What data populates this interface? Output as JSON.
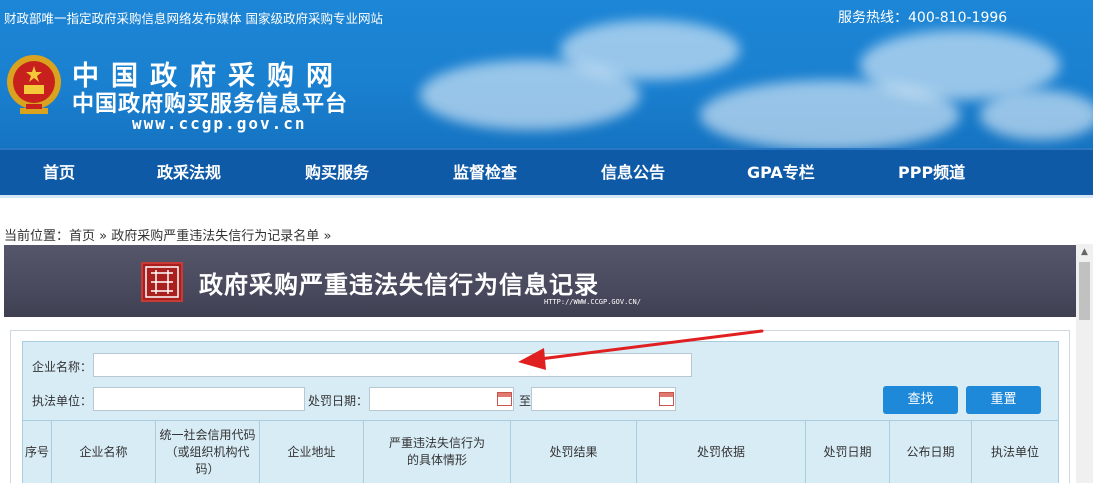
{
  "header": {
    "tagline": "财政部唯一指定政府采购信息网络发布媒体 国家级政府采购专业网站",
    "hotline": "服务热线：400-810-1996",
    "logo_line1": "中国政府采购网",
    "logo_line2": "中国政府购买服务信息平台",
    "logo_url": "www.ccgp.gov.cn"
  },
  "nav": {
    "items": [
      "首页",
      "政采法规",
      "购买服务",
      "监督检查",
      "信息公告",
      "GPA专栏",
      "PPP频道"
    ]
  },
  "breadcrumb": {
    "prefix": "当前位置：",
    "home": "首页",
    "sep": "»",
    "current": "政府采购严重违法失信行为记录名单",
    "trail": "»"
  },
  "banner": {
    "title": "政府采购严重违法失信行为信息记录",
    "url": "HTTP://WWW.CCGP.GOV.CN/"
  },
  "search": {
    "company_label": "企业名称：",
    "company_value": "",
    "agency_label": "执法单位：",
    "agency_value": "",
    "date_label": "处罚日期：",
    "date_from": "",
    "date_to_label": "至",
    "date_to": "",
    "search_button": "查找",
    "reset_button": "重置"
  },
  "table": {
    "headers": [
      [
        "序号"
      ],
      [
        "企业名称"
      ],
      [
        "统一社会信用代码",
        "（或组织机构代",
        "码）"
      ],
      [
        "企业地址"
      ],
      [
        "严重违法失信行为",
        "的具体情形"
      ],
      [
        "处罚结果"
      ],
      [
        "处罚依据"
      ],
      [
        "处罚日期"
      ],
      [
        "公布日期"
      ],
      [
        "执法单位"
      ]
    ]
  },
  "colors": {
    "header_blue": "#1a7fcf",
    "nav_blue": "#0e5aa6",
    "panel_bg": "#d8ecf6",
    "button_blue": "#1e88d9",
    "arrow_red": "#e02020"
  }
}
